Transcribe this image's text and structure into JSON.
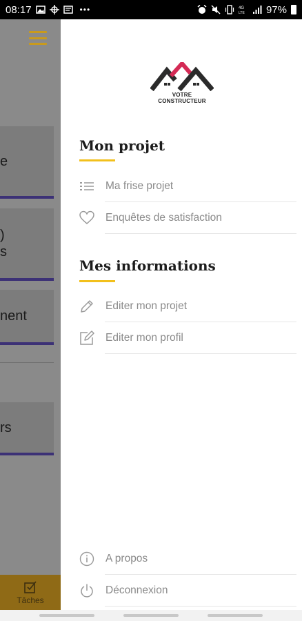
{
  "status_bar": {
    "time": "08:17",
    "overflow": "•••",
    "battery": "97%",
    "left_icons": [
      "gallery-icon",
      "crosshair-icon",
      "mail-icon"
    ],
    "right_icons": [
      "alarm-icon",
      "mute-icon",
      "vibrate-icon",
      "lte-icon",
      "signal-icon"
    ]
  },
  "background_app": {
    "accent_color": "#c99a1c",
    "cards": [
      {
        "text": "e"
      },
      {
        "text": ")\ns"
      },
      {
        "text": "nent"
      },
      {
        "text": "rs"
      }
    ],
    "bottom_tab": {
      "label": "Tâches",
      "icon": "task-check-icon"
    }
  },
  "drawer": {
    "logo_text": "VOTRE CONSTRUCTEUR",
    "sections": [
      {
        "title": "Mon projet",
        "items": [
          {
            "label": "Ma frise projet",
            "icon": "list-icon"
          },
          {
            "label": "Enquêtes de satisfaction",
            "icon": "heart-icon"
          }
        ]
      },
      {
        "title": "Mes informations",
        "items": [
          {
            "label": "Editer mon projet",
            "icon": "pencil-icon"
          },
          {
            "label": "Editer mon profil",
            "icon": "edit-square-icon"
          }
        ]
      }
    ],
    "footer_items": [
      {
        "label": "A propos",
        "icon": "info-icon"
      },
      {
        "label": "Déconnexion",
        "icon": "power-icon"
      }
    ],
    "accent_color": "#f2c01c"
  }
}
